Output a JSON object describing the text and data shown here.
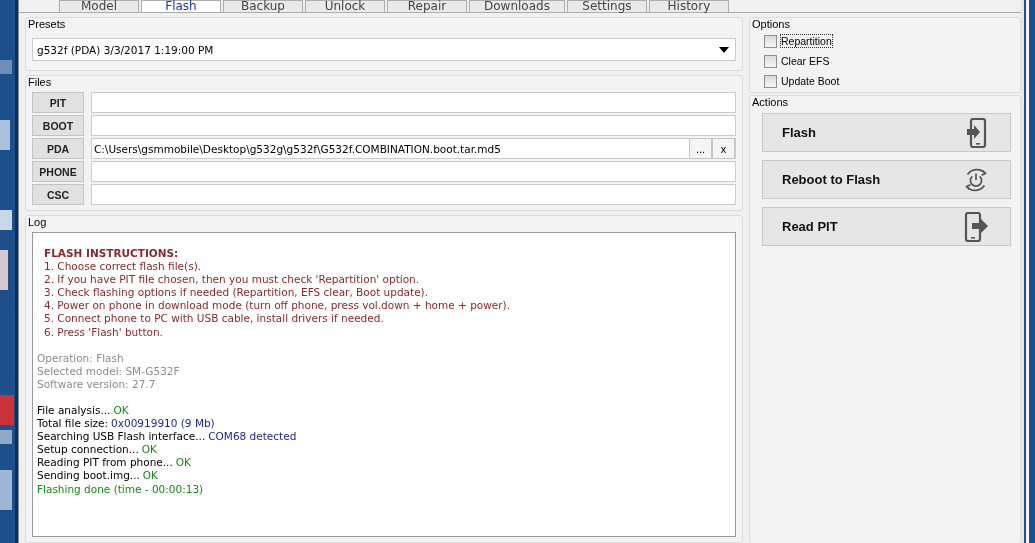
{
  "tabs": [
    {
      "label": "Model",
      "selected": false
    },
    {
      "label": "Flash",
      "selected": true
    },
    {
      "label": "Backup",
      "selected": false
    },
    {
      "label": "Unlock",
      "selected": false
    },
    {
      "label": "Repair",
      "selected": false
    },
    {
      "label": "Downloads",
      "selected": false
    },
    {
      "label": "Settings",
      "selected": false
    },
    {
      "label": "History",
      "selected": false
    }
  ],
  "presets": {
    "title": "Presets",
    "value": "g532f (PDA) 3/3/2017 1:19:00 PM"
  },
  "files": {
    "title": "Files",
    "rows": [
      {
        "label": "PIT",
        "value": ""
      },
      {
        "label": "BOOT",
        "value": ""
      },
      {
        "label": "PDA",
        "value": "C:\\Users\\gsmmobile\\Desktop\\g532g\\g532f\\G532f.COMBINATION.boot.tar.md5",
        "browse": "...",
        "clear": "x"
      },
      {
        "label": "PHONE",
        "value": ""
      },
      {
        "label": "CSC",
        "value": ""
      }
    ]
  },
  "log": {
    "title": "Log",
    "blocks": [
      {
        "lines": [
          [
            {
              "text": "FLASH INSTRUCTIONS:",
              "kind": "heading"
            }
          ],
          [
            {
              "text": "1. Choose correct flash file(s).",
              "kind": "instruction"
            }
          ],
          [
            {
              "text": "2. If you have PIT file chosen, then you must check 'Repartition' option.",
              "kind": "instruction"
            }
          ],
          [
            {
              "text": "3. Check flashing options if needed (Repartition, EFS clear, Boot update).",
              "kind": "instruction"
            }
          ],
          [
            {
              "text": "4. Power on phone in download mode (turn off phone, press vol.down + home + power).",
              "kind": "instruction"
            }
          ],
          [
            {
              "text": "5. Connect phone to PC with USB cable, install drivers if needed.",
              "kind": "instruction"
            }
          ],
          [
            {
              "text": "6. Press 'Flash' button.",
              "kind": "instruction"
            }
          ]
        ]
      },
      {
        "lines": [
          [
            {
              "text": "Operation: Flash",
              "kind": "info"
            }
          ],
          [
            {
              "text": "Selected model: SM-G532F",
              "kind": "info"
            }
          ],
          [
            {
              "text": "Software version: 27.7",
              "kind": "info"
            }
          ]
        ]
      },
      {
        "lines": [
          [
            {
              "text": "File analysis...",
              "kind": "normal"
            },
            {
              "text": "OK",
              "kind": "ok"
            }
          ],
          [
            {
              "text": "Total file size:",
              "kind": "normal"
            },
            {
              "text": "0x00919910 (9 Mb)",
              "kind": "value"
            }
          ],
          [
            {
              "text": "Searching USB Flash interface...",
              "kind": "normal"
            },
            {
              "text": "COM68 detected",
              "kind": "value"
            }
          ],
          [
            {
              "text": "Setup connection...",
              "kind": "normal"
            },
            {
              "text": "OK",
              "kind": "ok"
            }
          ],
          [
            {
              "text": "Reading PIT from phone...",
              "kind": "normal"
            },
            {
              "text": "OK",
              "kind": "ok"
            }
          ],
          [
            {
              "text": "Sending boot.img...",
              "kind": "normal"
            },
            {
              "text": "OK",
              "kind": "ok"
            }
          ],
          [
            {
              "text": "Flashing done (time - 00:00:13)",
              "kind": "ok"
            }
          ]
        ]
      }
    ]
  },
  "options": {
    "title": "Options",
    "items": [
      {
        "label": "Repartition",
        "checked": false,
        "focused": true
      },
      {
        "label": "Clear EFS",
        "checked": false,
        "focused": false
      },
      {
        "label": "Update Boot",
        "checked": false,
        "focused": false
      }
    ]
  },
  "actions": {
    "title": "Actions",
    "buttons": [
      {
        "label": "Flash",
        "kind": "phone-in"
      },
      {
        "label": "Reboot to Flash",
        "kind": "reboot"
      },
      {
        "label": "Read PIT",
        "kind": "phone-out"
      }
    ]
  }
}
